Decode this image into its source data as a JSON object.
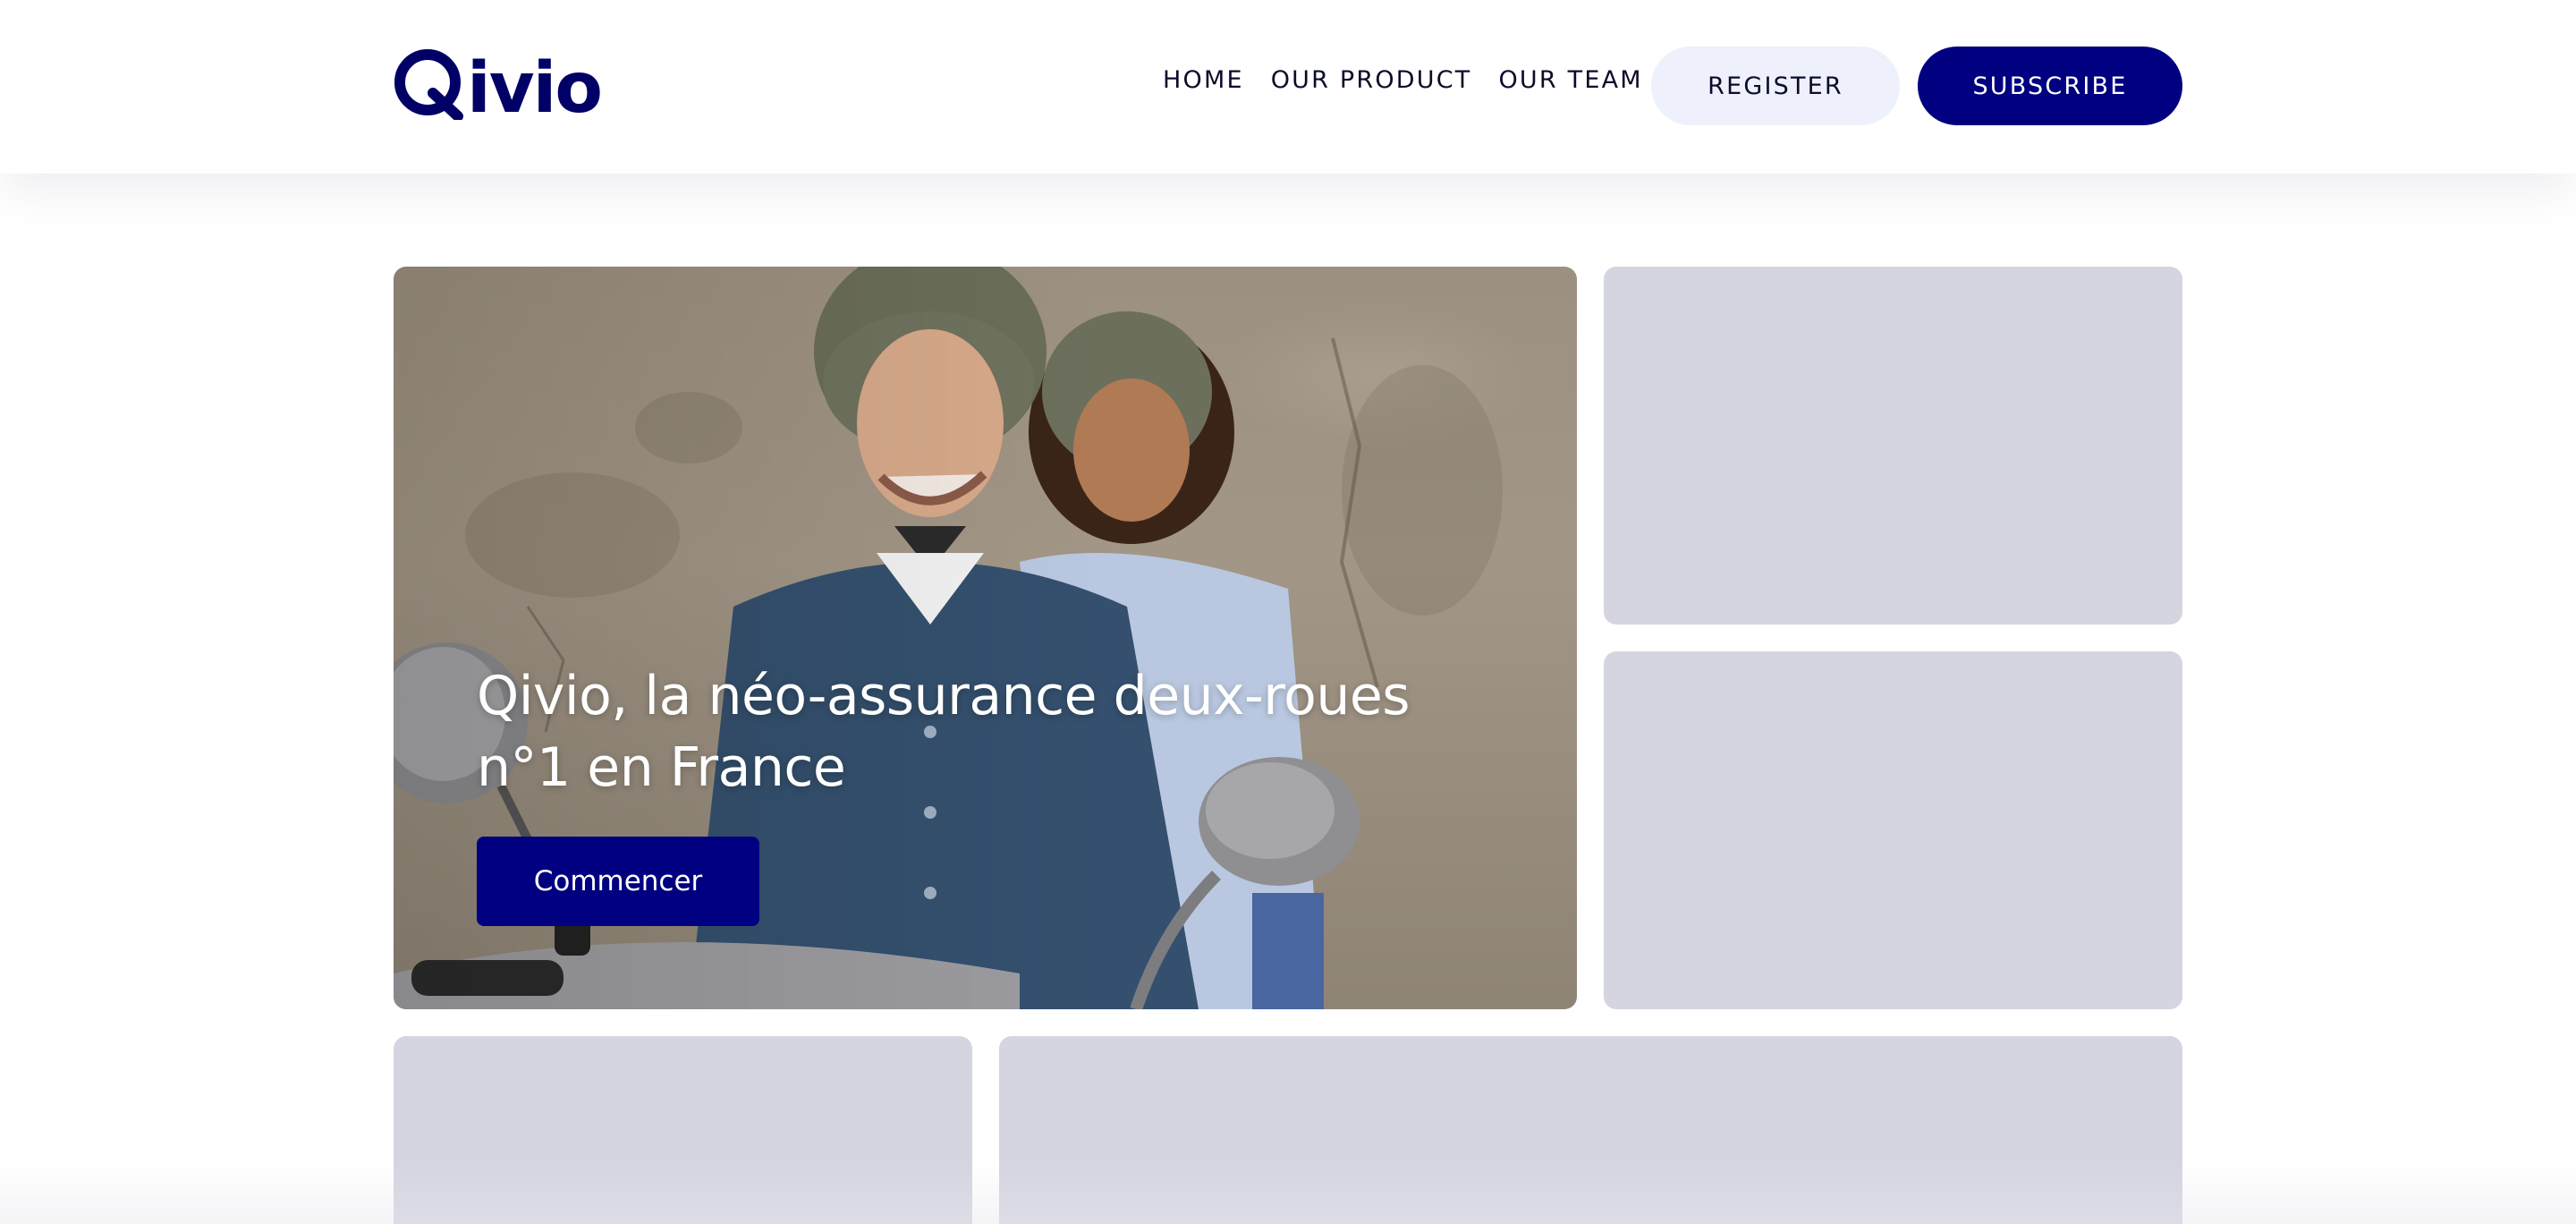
{
  "header": {
    "logo_text": "ivio",
    "logo_full": "Qivio",
    "nav": [
      {
        "label": "HOME"
      },
      {
        "label": "OUR PRODUCT"
      },
      {
        "label": "OUR TEAM"
      }
    ],
    "register_label": "REGISTER",
    "subscribe_label": "SUBSCRIBE"
  },
  "hero": {
    "title": "Qivio, la néo-assurance deux-roues n°1 en France",
    "cta_label": "Commencer"
  },
  "colors": {
    "brand": "#000080",
    "register_bg": "#eef1fb",
    "placeholder": "#d5d5e1"
  }
}
